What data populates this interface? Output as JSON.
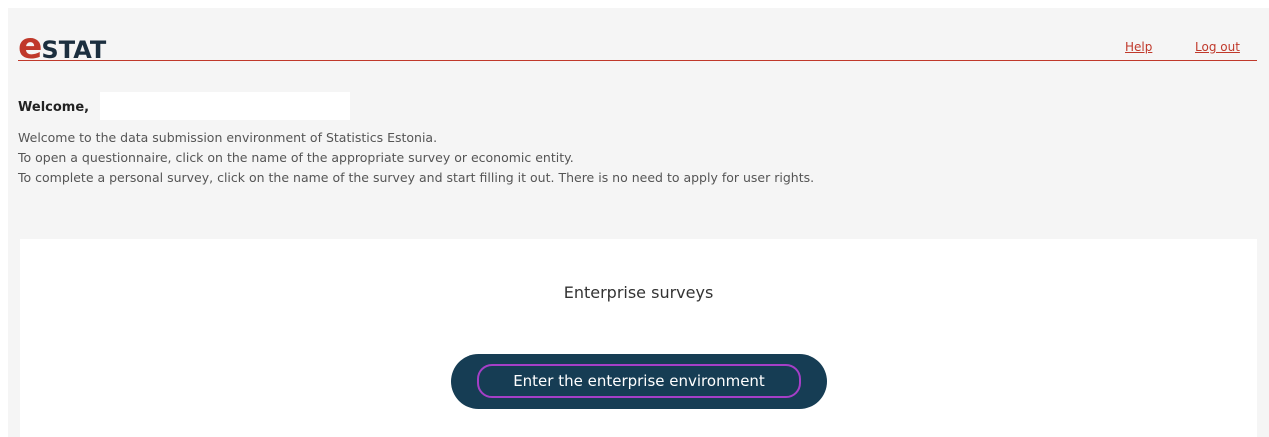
{
  "header": {
    "logo": {
      "e_letter": "e",
      "rest": "STAT",
      "e_color": "#c0392b",
      "rest_color": "#1c2f3f"
    },
    "links": {
      "help": "Help",
      "logout": "Log out"
    },
    "rule_color": "#c0392b"
  },
  "welcome": {
    "heading": "Welcome,",
    "lines": [
      "Welcome to the data submission environment of Statistics Estonia.",
      "To open a questionnaire, click on the name of the appropriate survey or economic entity.",
      "To complete a personal survey, click on the name of the survey and start filling it out. There is no need to apply for user rights."
    ]
  },
  "enterprise": {
    "title": "Enterprise surveys",
    "button_label": "Enter the enterprise environment",
    "button_color": "#163d54",
    "focus_outline_color": "#a53fc7"
  }
}
